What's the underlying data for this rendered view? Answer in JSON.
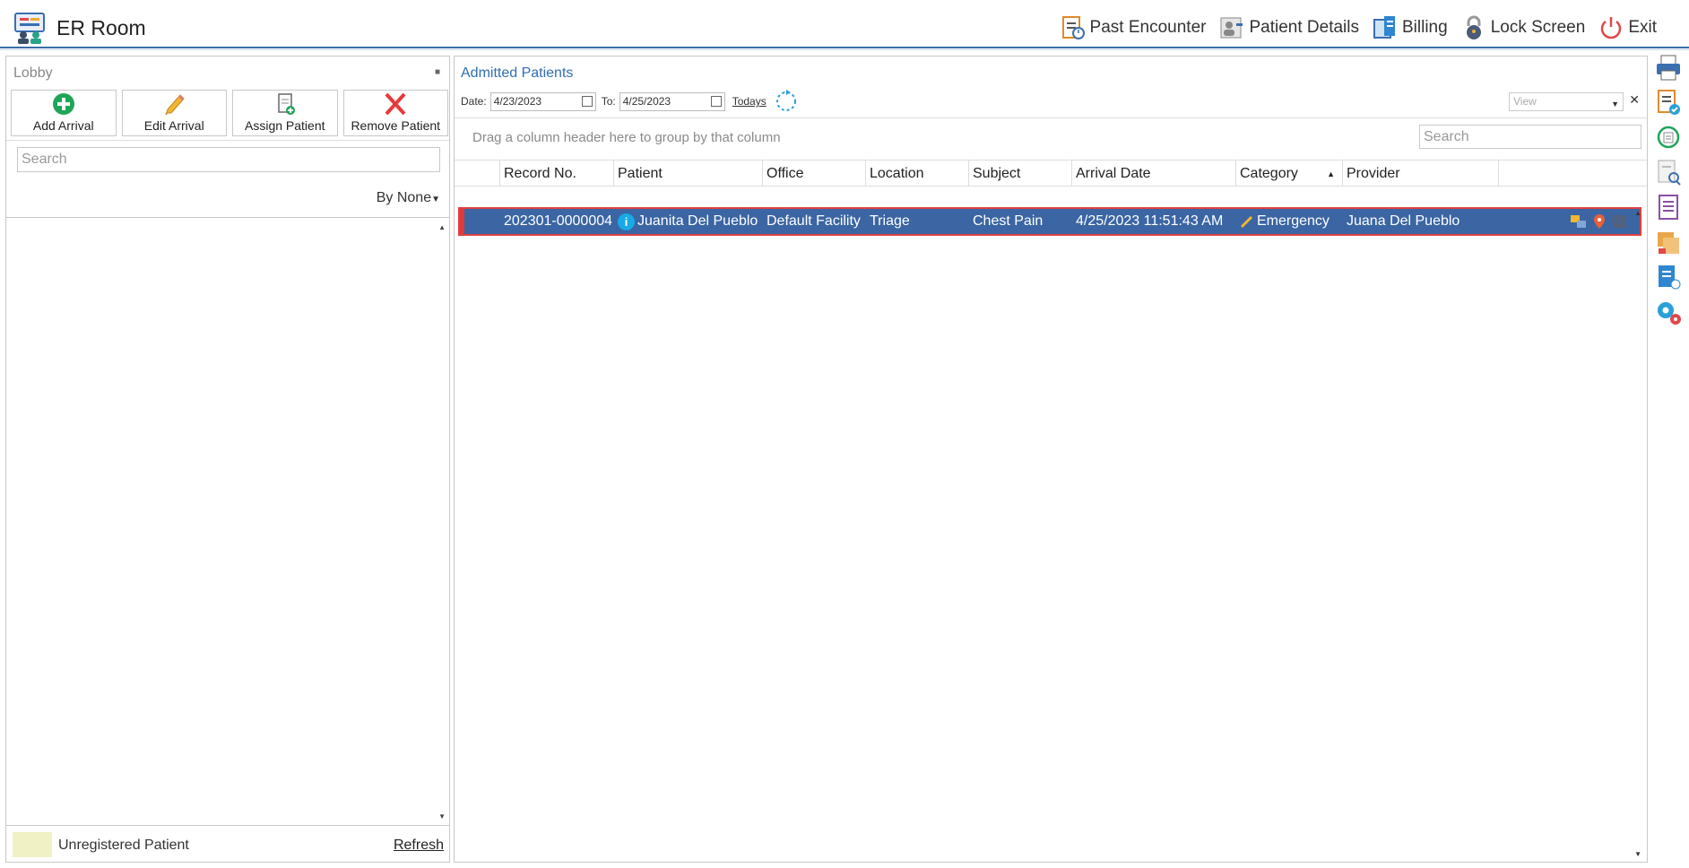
{
  "app": {
    "title": "ER Room"
  },
  "top_actions": [
    {
      "label": "Past Encounter",
      "icon": "past-encounter-icon"
    },
    {
      "label": "Patient Details",
      "icon": "patient-details-icon"
    },
    {
      "label": "Billing",
      "icon": "billing-icon"
    },
    {
      "label": "Lock Screen",
      "icon": "lock-icon"
    },
    {
      "label": "Exit",
      "icon": "power-icon"
    }
  ],
  "lobby": {
    "title": "Lobby",
    "buttons": [
      {
        "label": "Add Arrival",
        "icon": "plus-circle-icon"
      },
      {
        "label": "Edit Arrival",
        "icon": "pencil-icon"
      },
      {
        "label": "Assign Patient",
        "icon": "clipboard-add-icon"
      },
      {
        "label": "Remove Patient",
        "icon": "red-x-icon"
      }
    ],
    "search_placeholder": "Search",
    "group_by": "By None",
    "legend_label": "Unregistered Patient",
    "legend_color": "#f0f2c6",
    "refresh_label": "Refresh"
  },
  "admitted": {
    "title": "Admitted Patients",
    "date_label": "Date:",
    "date_from": "4/23/2023",
    "to_label": "To:",
    "date_to": "4/25/2023",
    "todays_label": "Todays",
    "view_placeholder": "View",
    "group_hint": "Drag a column header here to group by that column",
    "search_placeholder": "Search",
    "columns": [
      "Record No.",
      "Patient",
      "Office",
      "Location",
      "Subject",
      "Arrival Date",
      "Category",
      "Provider"
    ],
    "rows": [
      {
        "record_no": "202301-0000004",
        "patient": "Juanita Del Pueblo",
        "office": "Default Facility",
        "location": "Triage",
        "subject": "Chest Pain",
        "arrival_date": "4/25/2023 11:51:43 AM",
        "category": "Emergency",
        "provider": "Juana Del Pueblo"
      }
    ]
  },
  "colors": {
    "accent": "#2f6fb1",
    "selected_row": "#3b65a3",
    "row_highlight_border": "#e04040"
  }
}
